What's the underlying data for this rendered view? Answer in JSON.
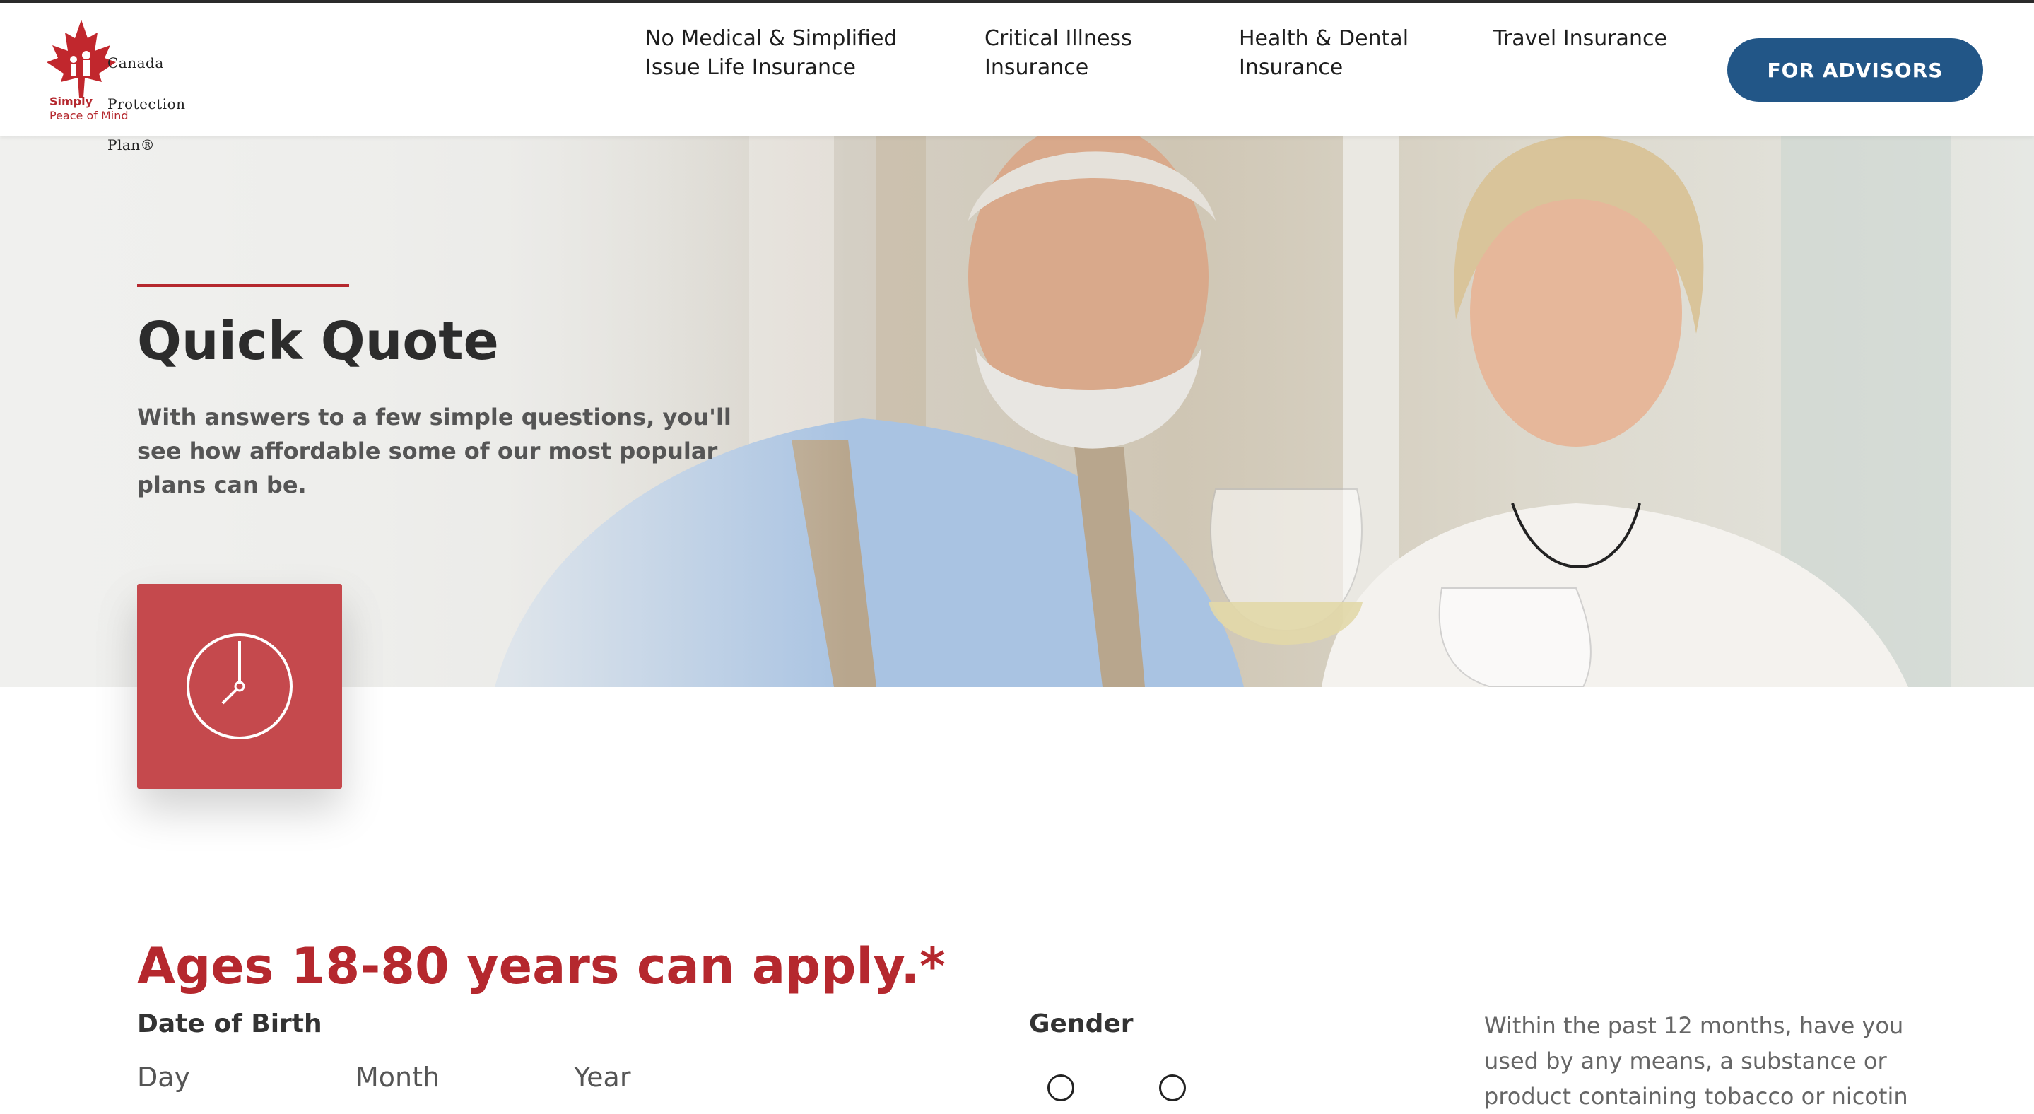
{
  "brand": {
    "name_lines": [
      "Canada",
      "Protection",
      "Plan®"
    ],
    "tagline_1": "Simply",
    "tagline_2": "Peace of Mind"
  },
  "nav": {
    "items": [
      {
        "line1": "No Medical & Simplified",
        "line2": "Issue Life Insurance"
      },
      {
        "line1": "Critical Illness",
        "line2": "Insurance"
      },
      {
        "line1": "Health & Dental",
        "line2": "Insurance"
      },
      {
        "line1": "Travel Insurance",
        "line2": ""
      }
    ],
    "advisors_label": "FOR ADVISORS"
  },
  "hero": {
    "title": "Quick Quote",
    "text_lines": [
      "With answers to a few simple questions, you'll",
      "see how affordable some of our most popular",
      "plans can be."
    ],
    "icon": "clock-icon"
  },
  "form": {
    "heading": "Ages 18-80 years can apply.*",
    "dob_label": "Date of Birth",
    "day_placeholder": "Day",
    "month_placeholder": "Month",
    "year_placeholder": "Year",
    "gender_label": "Gender",
    "question_lines": [
      "Within the past 12 months, have you",
      "used by any means, a substance or",
      "product containing tobacco or nicotin"
    ]
  },
  "colors": {
    "brand_red": "#b5282e",
    "advisor_blue": "#225687",
    "clock_box": "#c5494d"
  }
}
